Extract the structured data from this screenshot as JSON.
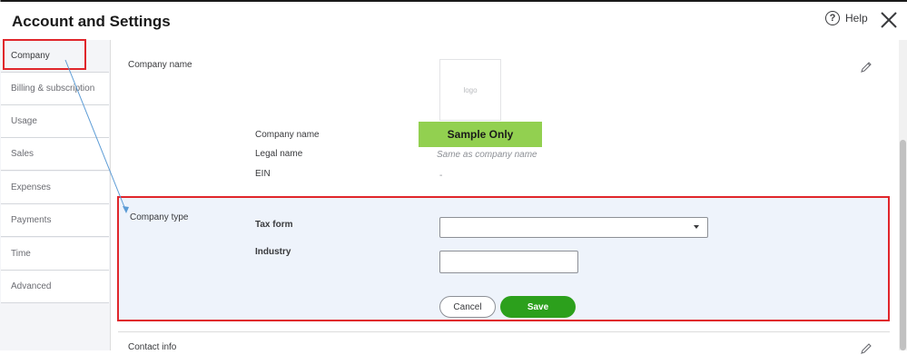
{
  "header": {
    "title": "Account and Settings",
    "help_label": "Help",
    "help_glyph": "?"
  },
  "sidebar": {
    "items": [
      {
        "label": "Company",
        "active": true
      },
      {
        "label": "Billing & subscription",
        "active": false
      },
      {
        "label": "Usage",
        "active": false
      },
      {
        "label": "Sales",
        "active": false
      },
      {
        "label": "Expenses",
        "active": false
      },
      {
        "label": "Payments",
        "active": false
      },
      {
        "label": "Time",
        "active": false
      },
      {
        "label": "Advanced",
        "active": false
      }
    ]
  },
  "company_name_section": {
    "label": "Company name",
    "logo_placeholder": "logo",
    "fields": [
      {
        "label": "Company name",
        "value": "Sample Only"
      },
      {
        "label": "Legal name",
        "value": "Same as company name"
      },
      {
        "label": "EIN",
        "value": "-"
      }
    ]
  },
  "company_type_section": {
    "label": "Company type",
    "tax_form_label": "Tax form",
    "tax_form_value": "",
    "industry_label": "Industry",
    "industry_value": "",
    "cancel_label": "Cancel",
    "save_label": "Save"
  },
  "contact_info_section": {
    "label": "Contact info"
  },
  "colors": {
    "accent_green": "#2ca01c",
    "highlight_red": "#e0262b",
    "sample_green": "#92d050",
    "arrow_blue": "#5b9bd5"
  }
}
